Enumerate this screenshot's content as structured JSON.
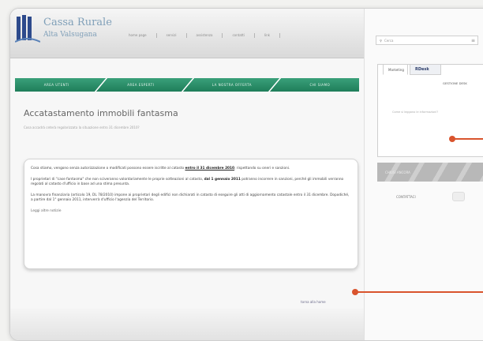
{
  "header": {
    "brand_line1": "Cassa Rurale",
    "brand_line2": "Alta Valsugana",
    "topnav": [
      "home page",
      "servizi",
      "assistenza",
      "contatti",
      "link"
    ]
  },
  "green_nav": [
    "AREA UTENTI",
    "AREA ESPERTI",
    "LA NOSTRA OFFERTA",
    "CHI SIAMO"
  ],
  "main": {
    "title": "Accatastamento immobili fantasma",
    "subtitle": "Cosa accadrà ceterà regolarizzata la situazione entro 31 dicembre 2010?",
    "p1_a": "Cosa stiamo, vengono senza autorizzazione o modificati possono essere iscritte al catasto ",
    "p1_bold": "entro il 31 dicembre 2010",
    "p1_b": ", rispettando su oneri e sanzioni.",
    "p2_a": "I proprietari di \"case fantasma\" che non sciveranno volontariamente le proprie sotteazioni al catasto, ",
    "p2_bold": "dal 1 gennaio 2011",
    "p2_b": " potranno incorrere in sanzioni, perché gli immobili verranno regolati al catasto d'ufficio in base ad una stima presunta.",
    "p3": "La manovra finanziaria (articolo 19, DL 78/2010) impone ai proprietari degli edifici non dichiarati in catasto di eseguire gli atti di aggiornamento catastale entro il 31 dicembre. Dopodiché, a partire dal 1° gennaio 2011, interverrà d'ufficio l'agenzia del Territorio.",
    "more": "Leggi altre notizie",
    "footer_link": "torna alla home"
  },
  "sidebar": {
    "search_placeholder": "Cerca",
    "tab1": "Marketing",
    "tab2": "RDesk",
    "manage": "GESTIONE DESK",
    "note": "Come si leggono le informazioni?",
    "stripe_label": "CHIUSI ANCORA",
    "contact": "CONTATTACI"
  },
  "colors": {
    "accent_green": "#2a8f68",
    "callout": "#d9542d"
  }
}
